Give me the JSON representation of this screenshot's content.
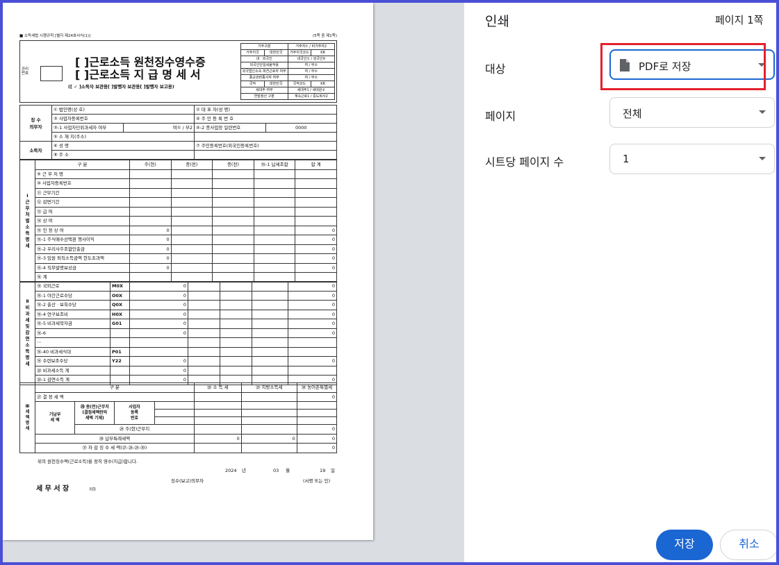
{
  "panel": {
    "title": "인쇄",
    "page_count": "페이지 1쪽",
    "destination_label": "대상",
    "destination_value": "PDF로 저장",
    "pages_label": "페이지",
    "pages_value": "전체",
    "per_sheet_label": "시트당 페이지 수",
    "per_sheet_value": "1",
    "save": "저장",
    "cancel": "취소",
    "highlight_color": "#e5202b",
    "accent": "#1a66d2"
  },
  "doc": {
    "header_left": "■ 소득세법 시행규칙 [별지 제24호서식(1)]",
    "header_right": "(5쪽 중 제1쪽)",
    "mgmt_no": "관리\n번호",
    "title1": "[  ]근로소득 원천징수영수증",
    "title2": "[  ]근로소득 지 급 명 세 서",
    "title_sub": "([ ✓ ]소득자 보관용[   ]발행자 보관용[   ]발행자 보고용)",
    "resident_rows": [
      [
        "거주구분",
        "거주자① / 비거주자2"
      ],
      [
        "거주지국",
        "대한민국",
        "거주지국코드",
        "KR"
      ],
      [
        "내ㆍ외국인",
        "내국인① / 외국인9"
      ],
      [
        "외국인단일세율적용",
        "여 / 부②"
      ],
      [
        "외국법인소속 파견근로자 여부",
        "여 / 부②"
      ],
      [
        "종교관련종사자 여부",
        "여 / 부②"
      ],
      [
        "국적",
        "대한민국",
        "국적코드",
        "KR"
      ],
      [
        "세대주 여부",
        "세대주1 / 세대원②"
      ],
      [
        "연말정산 구분",
        "계속근로1 / 중도퇴사2"
      ]
    ],
    "payer_label": "징 수\n의무자",
    "earner_label": "소득자",
    "payer_rows": [
      [
        "① 법인명(상 호)",
        "② 대 표 자(성  명)"
      ],
      [
        "③ 사업자등록번호",
        "④ 주 민 등 록 번 호"
      ],
      [
        "③-1 사업자단위과세자 여부",
        "여① / 부2",
        "④-2 종사업장 일련번호",
        "0000"
      ],
      [
        "⑤ 소 재 지(주소)",
        ""
      ],
      [
        "⑥ 성      명",
        "⑦ 주민등록번호(외국인등록번호)"
      ],
      [
        "⑧ 주      소",
        ""
      ]
    ],
    "work_label": "Ⅰ\n근\n무\n처\n별\n소\n득\n명\n세",
    "work_head": [
      "구  분",
      "주(현)",
      "종(전)",
      "종(전)",
      "⑯-1 납세조합",
      "합  계"
    ],
    "work_rows": [
      [
        "⑨ 근 무 처 명",
        "",
        "",
        ""
      ],
      [
        "⑩ 사업자등록번호",
        "",
        "",
        ""
      ],
      [
        "⑪ 근무기간",
        "",
        "",
        ""
      ],
      [
        "⑫ 감면기간",
        "",
        "",
        ""
      ],
      [
        "⑬ 급      여",
        "",
        "",
        ""
      ],
      [
        "⑭ 상      여",
        "",
        "",
        ""
      ],
      [
        "⑮ 인 정 상 여",
        "0",
        "",
        "0"
      ],
      [
        "⑮-1 주식매수선택권 행사이익",
        "0",
        "",
        "0"
      ],
      [
        "⑮-2 우리사주조합인출금",
        "0",
        "",
        "0"
      ],
      [
        "⑮-3 임원 퇴직소득금액 한도초과액",
        "0",
        "",
        "0"
      ],
      [
        "⑮-4 직무발명보상금",
        "0",
        "",
        "0"
      ],
      [
        "⑯ 계",
        "",
        "",
        ""
      ]
    ],
    "nontax_label": "Ⅱ\n비\n과\n세\n및\n감\n면\n소\n득\n명\n세",
    "nontax_rows": [
      [
        "⑱ 국외근로",
        "M0X",
        "0",
        "0"
      ],
      [
        "⑱-1 야간근로수당",
        "O0X",
        "0",
        "0"
      ],
      [
        "⑱-2 출산ㆍ보육수당",
        "Q0X",
        "0",
        "0"
      ],
      [
        "⑱-4 연구보조비",
        "H0X",
        "0",
        "0"
      ],
      [
        "⑱-5 비과세학자금",
        "G01",
        "0",
        "0"
      ],
      [
        "⑱-6",
        "",
        "0",
        "0"
      ],
      [
        "⋯",
        "",
        "",
        ""
      ],
      [
        "⑱-40 비과세식대",
        "P01",
        "",
        ""
      ],
      [
        "⑲ 수련보조수당",
        "Y22",
        "0",
        "0"
      ],
      [
        "⑳ 비과세소득 계",
        "",
        "0",
        ""
      ],
      [
        "⑳-1 감면소득 계",
        "",
        "0",
        "0"
      ]
    ],
    "tax_label": "Ⅲ\n세\n액\n명\n세",
    "tax_head": [
      "구  분",
      "㉘ 소 득 세",
      "㉙ 지방소득세",
      "㉚ 농어촌특별세"
    ],
    "tax_rows": {
      "determined": [
        "㉗ 결  정  세  액",
        "0"
      ],
      "prev_group": "기납부\n세 액",
      "prev": "㉘ 종(전)근무지\n(결정세액란의\n세액 기재)",
      "biz_no": "사업자\n등록\n번호",
      "current": [
        "㉙ 주(현)근무지",
        "0"
      ],
      "special": [
        "㉚ 납부특례세액",
        "0",
        "0",
        "0"
      ],
      "diff": [
        "㉛ 차 감 징 수 세 액(㉗-㉘-㉙-㉚)",
        "0"
      ]
    },
    "confirm": "위의 원천징수액(근로소득)을 정히 영수(지급)합니다.",
    "date": [
      "2024",
      "년",
      "03",
      "월",
      "19",
      "일"
    ],
    "payer_sign": "징수(보고)의무자",
    "seal": "(서명 또는 인)",
    "office": "세 무 서 장",
    "office_suffix": "귀하"
  }
}
